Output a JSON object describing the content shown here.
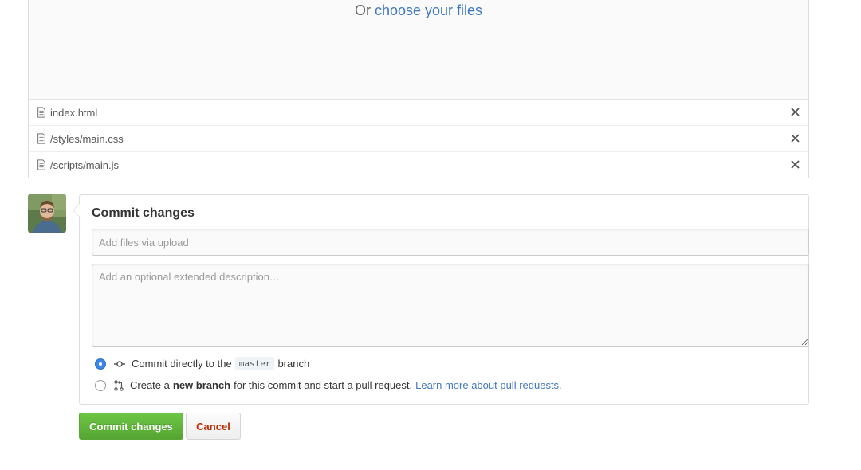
{
  "dropzone": {
    "prefix": "Or",
    "link": "choose your files"
  },
  "files": [
    {
      "name": "index.html",
      "icon": "file-icon",
      "remove_icon": "close-icon"
    },
    {
      "name": "/styles/main.css",
      "icon": "file-icon",
      "remove_icon": "close-icon"
    },
    {
      "name": "/scripts/main.js",
      "icon": "file-icon",
      "remove_icon": "close-icon"
    }
  ],
  "commit": {
    "title": "Commit changes",
    "summary_placeholder": "Add files via upload",
    "summary_value": "",
    "description_placeholder": "Add an optional extended description…",
    "description_value": "",
    "option_direct": {
      "checked": true,
      "icon": "git-commit-icon",
      "text_before": "Commit directly to the",
      "branch": "master",
      "text_after": "branch"
    },
    "option_new_branch": {
      "checked": false,
      "icon": "git-pull-request-icon",
      "text_before": "Create a",
      "bold": "new branch",
      "text_after": "for this commit and start a pull request.",
      "link": "Learn more about pull requests."
    }
  },
  "buttons": {
    "commit_label": "Commit changes",
    "cancel_label": "Cancel"
  },
  "colors": {
    "link": "#4078c0",
    "commit_button": "#55a532",
    "cancel_text": "#bd2c00",
    "radio_checked": "#3a85e8"
  }
}
